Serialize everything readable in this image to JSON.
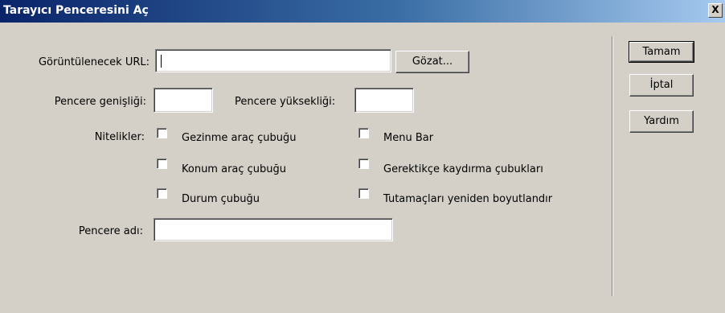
{
  "window": {
    "title": "Tarayıcı Penceresini Aç",
    "close_label": "X"
  },
  "form": {
    "url_label": "Görüntülenecek URL:",
    "url_value": "",
    "browse_label": "Gözat...",
    "width_label": "Pencere genişliği:",
    "width_value": "",
    "height_label": "Pencere yüksekliği:",
    "height_value": "",
    "attributes_label": "Nitelikler:",
    "attributes": [
      {
        "label": "Gezinme araç çubuğu",
        "checked": false
      },
      {
        "label": "Konum araç çubuğu",
        "checked": false
      },
      {
        "label": "Durum çubuğu",
        "checked": false
      },
      {
        "label": "Menu Bar",
        "checked": false
      },
      {
        "label": "Gerektikçe kaydırma çubukları",
        "checked": false
      },
      {
        "label": "Tutamaçları yeniden boyutlandır",
        "checked": false
      }
    ],
    "window_name_label": "Pencere adı:",
    "window_name_value": ""
  },
  "buttons": {
    "ok": "Tamam",
    "cancel": "İptal",
    "help": "Yardım"
  }
}
